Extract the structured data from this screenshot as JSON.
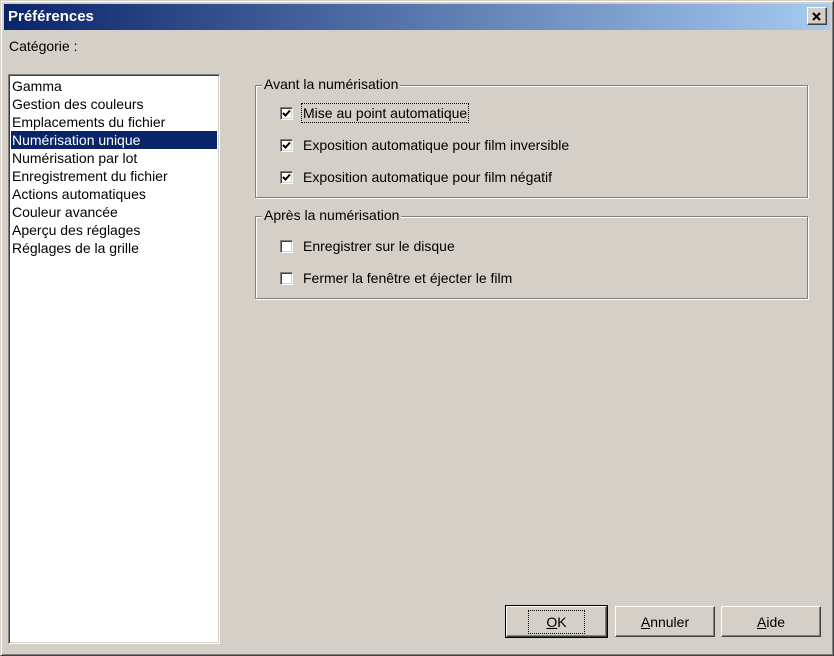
{
  "window": {
    "title": "Préférences",
    "close_symbol": "×"
  },
  "category": {
    "label": "Catégorie :",
    "items": [
      "Gamma",
      "Gestion des couleurs",
      "Emplacements du fichier",
      "Numérisation unique",
      "Numérisation par lot",
      "Enregistrement du fichier",
      "Actions automatiques",
      "Couleur avancée",
      "Aperçu des réglages",
      "Réglages de la grille"
    ],
    "selected": "Numérisation unique"
  },
  "before_scan": {
    "title": "Avant la numérisation",
    "options": [
      {
        "label": "Mise au point automatique",
        "checked": true
      },
      {
        "label": "Exposition automatique pour film inversible",
        "checked": true
      },
      {
        "label": "Exposition automatique pour film négatif",
        "checked": true
      }
    ]
  },
  "after_scan": {
    "title": "Après la numérisation",
    "options": [
      {
        "label": "Enregistrer sur le disque",
        "checked": false
      },
      {
        "label": "Fermer la fenêtre et éjecter le film",
        "checked": false
      }
    ]
  },
  "buttons": {
    "ok": {
      "mnemonic": "O",
      "rest": "K"
    },
    "cancel": {
      "mnemonic": "A",
      "rest": "nnuler"
    },
    "help": {
      "mnemonic": "A",
      "rest": "ide"
    }
  },
  "colors": {
    "face": "#d4d0c8",
    "title_start": "#0a246a",
    "title_end": "#a6caf0",
    "selection": "#0a246a"
  }
}
